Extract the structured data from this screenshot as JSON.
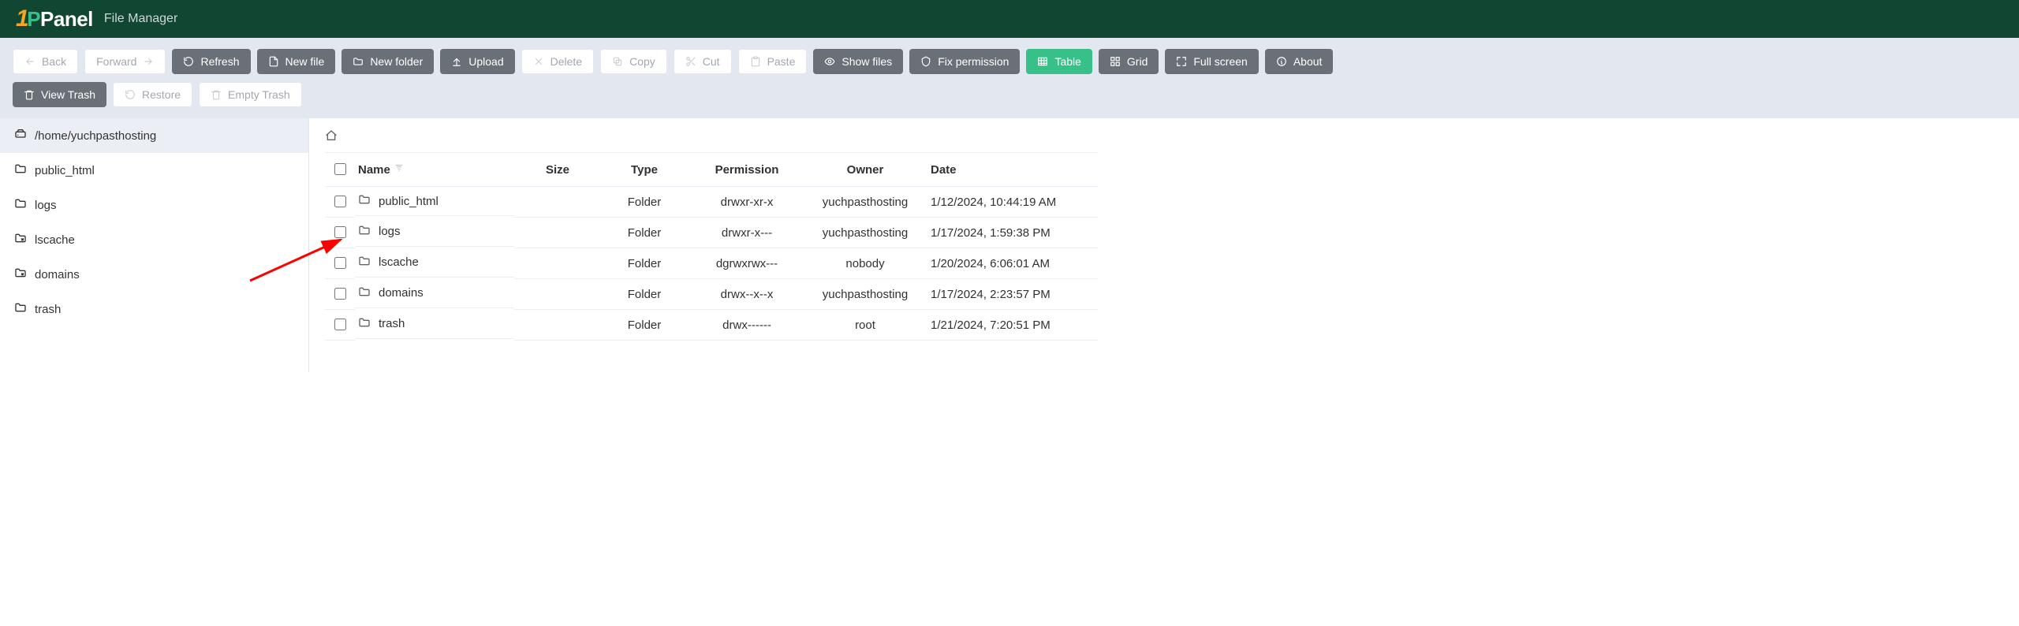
{
  "app": {
    "logo_brand": "Panel",
    "title": "File Manager"
  },
  "toolbar": {
    "back": "Back",
    "forward": "Forward",
    "refresh": "Refresh",
    "new_file": "New file",
    "new_folder": "New folder",
    "upload": "Upload",
    "delete": "Delete",
    "copy": "Copy",
    "cut": "Cut",
    "paste": "Paste",
    "show_files": "Show files",
    "fix_permission": "Fix permission",
    "table": "Table",
    "grid": "Grid",
    "full_screen": "Full screen",
    "about": "About",
    "view_trash": "View Trash",
    "restore": "Restore",
    "empty_trash": "Empty Trash"
  },
  "tree": {
    "root": "/home/yuchpasthosting",
    "items": [
      {
        "label": "public_html"
      },
      {
        "label": "logs"
      },
      {
        "label": "lscache"
      },
      {
        "label": "domains"
      },
      {
        "label": "trash"
      }
    ]
  },
  "table": {
    "headers": {
      "name": "Name",
      "size": "Size",
      "type": "Type",
      "permission": "Permission",
      "owner": "Owner",
      "date": "Date"
    },
    "rows": [
      {
        "name": "public_html",
        "size": "",
        "type": "Folder",
        "permission": "drwxr-xr-x",
        "owner": "yuchpasthosting",
        "date": "1/12/2024, 10:44:19 AM"
      },
      {
        "name": "logs",
        "size": "",
        "type": "Folder",
        "permission": "drwxr-x---",
        "owner": "yuchpasthosting",
        "date": "1/17/2024, 1:59:38 PM"
      },
      {
        "name": "lscache",
        "size": "",
        "type": "Folder",
        "permission": "dgrwxrwx---",
        "owner": "nobody",
        "date": "1/20/2024, 6:06:01 AM"
      },
      {
        "name": "domains",
        "size": "",
        "type": "Folder",
        "permission": "drwx--x--x",
        "owner": "yuchpasthosting",
        "date": "1/17/2024, 2:23:57 PM"
      },
      {
        "name": "trash",
        "size": "",
        "type": "Folder",
        "permission": "drwx------",
        "owner": "root",
        "date": "1/21/2024, 7:20:51 PM"
      }
    ]
  }
}
